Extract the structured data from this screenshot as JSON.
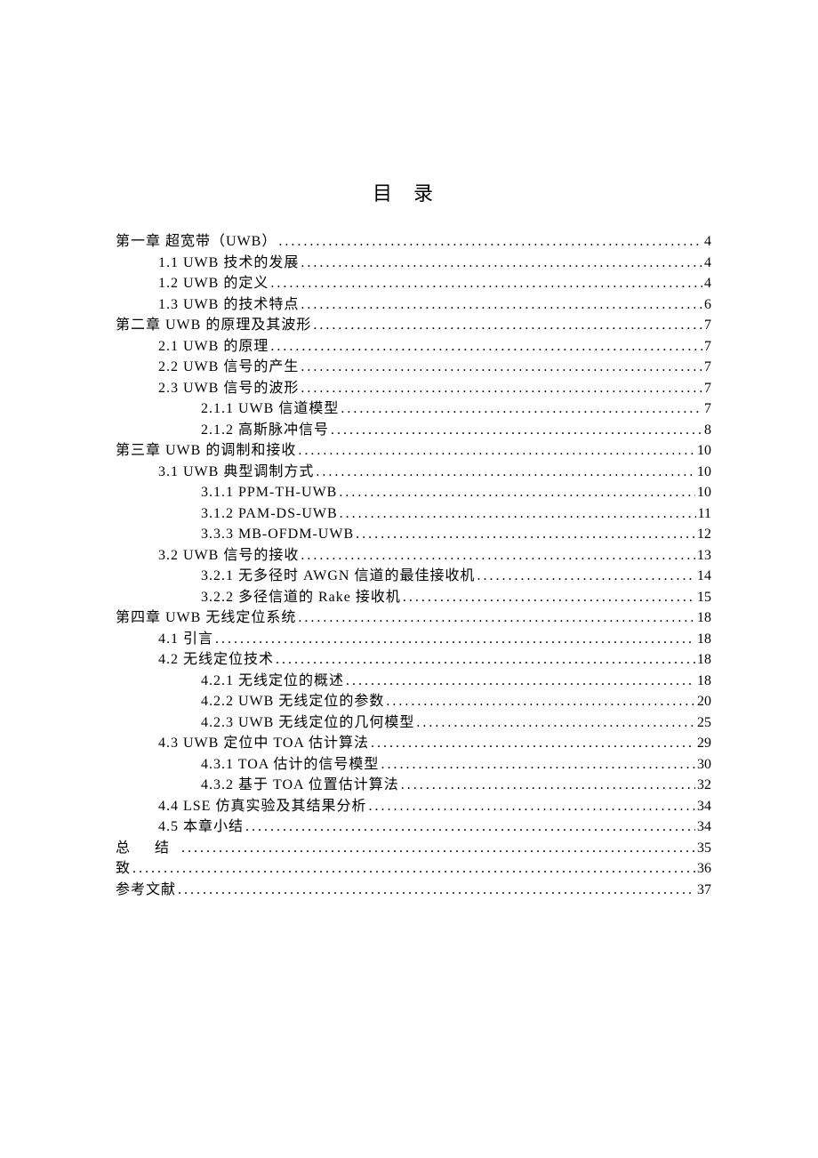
{
  "title": "目录",
  "toc": [
    {
      "level": 0,
      "text": "第一章 超宽带（UWB）",
      "page": "4"
    },
    {
      "level": 1,
      "text": "1.1 UWB 技术的发展",
      "page": "4"
    },
    {
      "level": 1,
      "text": "1.2 UWB 的定义",
      "page": "4"
    },
    {
      "level": 1,
      "text": "1.3 UWB 的技术特点",
      "page": "6"
    },
    {
      "level": 0,
      "text": "第二章 UWB 的原理及其波形",
      "page": "7"
    },
    {
      "level": 1,
      "text": "2.1 UWB 的原理",
      "page": "7"
    },
    {
      "level": 1,
      "text": "2.2 UWB 信号的产生",
      "page": "7"
    },
    {
      "level": 1,
      "text": "2.3 UWB 信号的波形",
      "page": "7"
    },
    {
      "level": 2,
      "text": "2.1.1 UWB 信道模型",
      "page": "7"
    },
    {
      "level": 2,
      "text": "2.1.2 高斯脉冲信号",
      "page": "8"
    },
    {
      "level": 0,
      "text": "第三章 UWB 的调制和接收",
      "page": "10"
    },
    {
      "level": 1,
      "text": "3.1 UWB 典型调制方式",
      "page": "10"
    },
    {
      "level": 2,
      "text": "3.1.1 PPM-TH-UWB",
      "page": "10"
    },
    {
      "level": 2,
      "text": "3.1.2 PAM-DS-UWB",
      "page": "11"
    },
    {
      "level": 2,
      "text": "3.3.3 MB-OFDM-UWB",
      "page": "12"
    },
    {
      "level": 1,
      "text": "3.2 UWB 信号的接收",
      "page": "13"
    },
    {
      "level": 2,
      "text": "3.2.1 无多径时 AWGN 信道的最佳接收机",
      "page": "14"
    },
    {
      "level": 2,
      "text": "3.2.2 多径信道的 Rake 接收机",
      "page": "15"
    },
    {
      "level": 0,
      "text": "第四章 UWB 无线定位系统",
      "page": "18"
    },
    {
      "level": 1,
      "text": "4.1 引言",
      "page": "18"
    },
    {
      "level": 1,
      "text": "4.2 无线定位技术",
      "page": "18"
    },
    {
      "level": 2,
      "text": "4.2.1 无线定位的概述",
      "page": "18"
    },
    {
      "level": 2,
      "text": "4.2.2 UWB 无线定位的参数",
      "page": "20"
    },
    {
      "level": 2,
      "text": "4.2.3 UWB 无线定位的几何模型",
      "page": "25"
    },
    {
      "level": 1,
      "text": "4.3 UWB 定位中 TOA 估计算法",
      "page": "29"
    },
    {
      "level": 2,
      "text": "4.3.1 TOA 估计的信号模型",
      "page": "30"
    },
    {
      "level": 2,
      "text": "4.3.2 基于 TOA 位置估计算法",
      "page": "32"
    },
    {
      "level": 1,
      "text": "4.4 LSE 仿真实验及其结果分析",
      "page": "34"
    },
    {
      "level": 1,
      "text": "4.5 本章小结",
      "page": "34"
    },
    {
      "level": 0,
      "text": "总 结",
      "page": "35",
      "spaced": true
    },
    {
      "level": 0,
      "text": "致",
      "page": "36"
    },
    {
      "level": 0,
      "text": "参考文献",
      "page": "37"
    }
  ]
}
